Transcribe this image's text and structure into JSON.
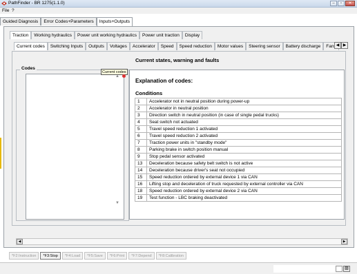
{
  "window": {
    "title": "PathFinder - BR 1275(1.1.0)",
    "buttons": {
      "minimize": "–",
      "maximize": "▫",
      "close": "✕"
    }
  },
  "menu": {
    "file": "File",
    "help": "?"
  },
  "top_tabs": [
    {
      "label": "Guided Diagnosis",
      "active": false
    },
    {
      "label": "Error Codes+Parameters",
      "active": false
    },
    {
      "label": "Inputs+Outputs",
      "active": true
    }
  ],
  "sub_tabs_1": [
    {
      "label": "Traction",
      "active": true
    },
    {
      "label": "Working hydraulics",
      "active": false
    },
    {
      "label": "Power unit working hydraulics",
      "active": false
    },
    {
      "label": "Power unit traction",
      "active": false
    },
    {
      "label": "Display",
      "active": false
    }
  ],
  "sub_tabs_2": [
    {
      "label": "Current codes",
      "active": true
    },
    {
      "label": "Switching Inputs",
      "active": false
    },
    {
      "label": "Outputs",
      "active": false
    },
    {
      "label": "Voltages",
      "active": false
    },
    {
      "label": "Accelerator",
      "active": false
    },
    {
      "label": "Speed",
      "active": false
    },
    {
      "label": "Speed reduction",
      "active": false
    },
    {
      "label": "Motor values",
      "active": false
    },
    {
      "label": "Steering sensor",
      "active": false
    },
    {
      "label": "Battery discharge",
      "active": false
    },
    {
      "label": "Fans",
      "active": false
    }
  ],
  "section_title": "Current states, warning and faults",
  "codes": {
    "group_label": "Codes",
    "tooltip": "Current codes",
    "scroll_up": "▲",
    "scroll_down": "▼"
  },
  "explanation": {
    "title": "Explanation of codes:",
    "conditions_title": "Conditions",
    "conditions": [
      {
        "num": "1",
        "text": "Accelerator not in neutral position during power-up"
      },
      {
        "num": "2",
        "text": "Accelerator in neutral position"
      },
      {
        "num": "3",
        "text": "Direction switch in neutral position (in case of single pedal trucks)"
      },
      {
        "num": "4",
        "text": "Seat switch not actuated"
      },
      {
        "num": "5",
        "text": "Travel speed reduction 1 activated"
      },
      {
        "num": "6",
        "text": "Travel speed reduction 2 activated"
      },
      {
        "num": "7",
        "text": "Traction power units in \"standby mode\""
      },
      {
        "num": "8",
        "text": "Parking brake in switch position manual"
      },
      {
        "num": "9",
        "text": "Stop pedal sensor activated"
      },
      {
        "num": "13",
        "text": "Deceleration because safety belt switch is not active"
      },
      {
        "num": "14",
        "text": "Deceleration because driver's seat not occupied"
      },
      {
        "num": "15",
        "text": "Speed reduction ordered by external device 1 via CAN"
      },
      {
        "num": "16",
        "text": "Lifting stop and deceleration of truck requested by external controller via CAN"
      },
      {
        "num": "18",
        "text": "Speed reduction ordered by external device 2 via CAN"
      },
      {
        "num": "19",
        "text": "Test function - LBC braking deactivated"
      }
    ]
  },
  "scroll_arrows": {
    "left": "◀",
    "right": "▶"
  },
  "function_keys": [
    {
      "label": "*F2:Instruction",
      "enabled": false
    },
    {
      "label": "*F3:Stop",
      "enabled": true
    },
    {
      "label": "*F4:Load",
      "enabled": false
    },
    {
      "label": "*F5:Save",
      "enabled": false
    },
    {
      "label": "*F6:Print",
      "enabled": false
    },
    {
      "label": "*F7:Depend",
      "enabled": false
    },
    {
      "label": "*F8:Calibration",
      "enabled": false
    }
  ],
  "status": {
    "grip": "▨"
  }
}
